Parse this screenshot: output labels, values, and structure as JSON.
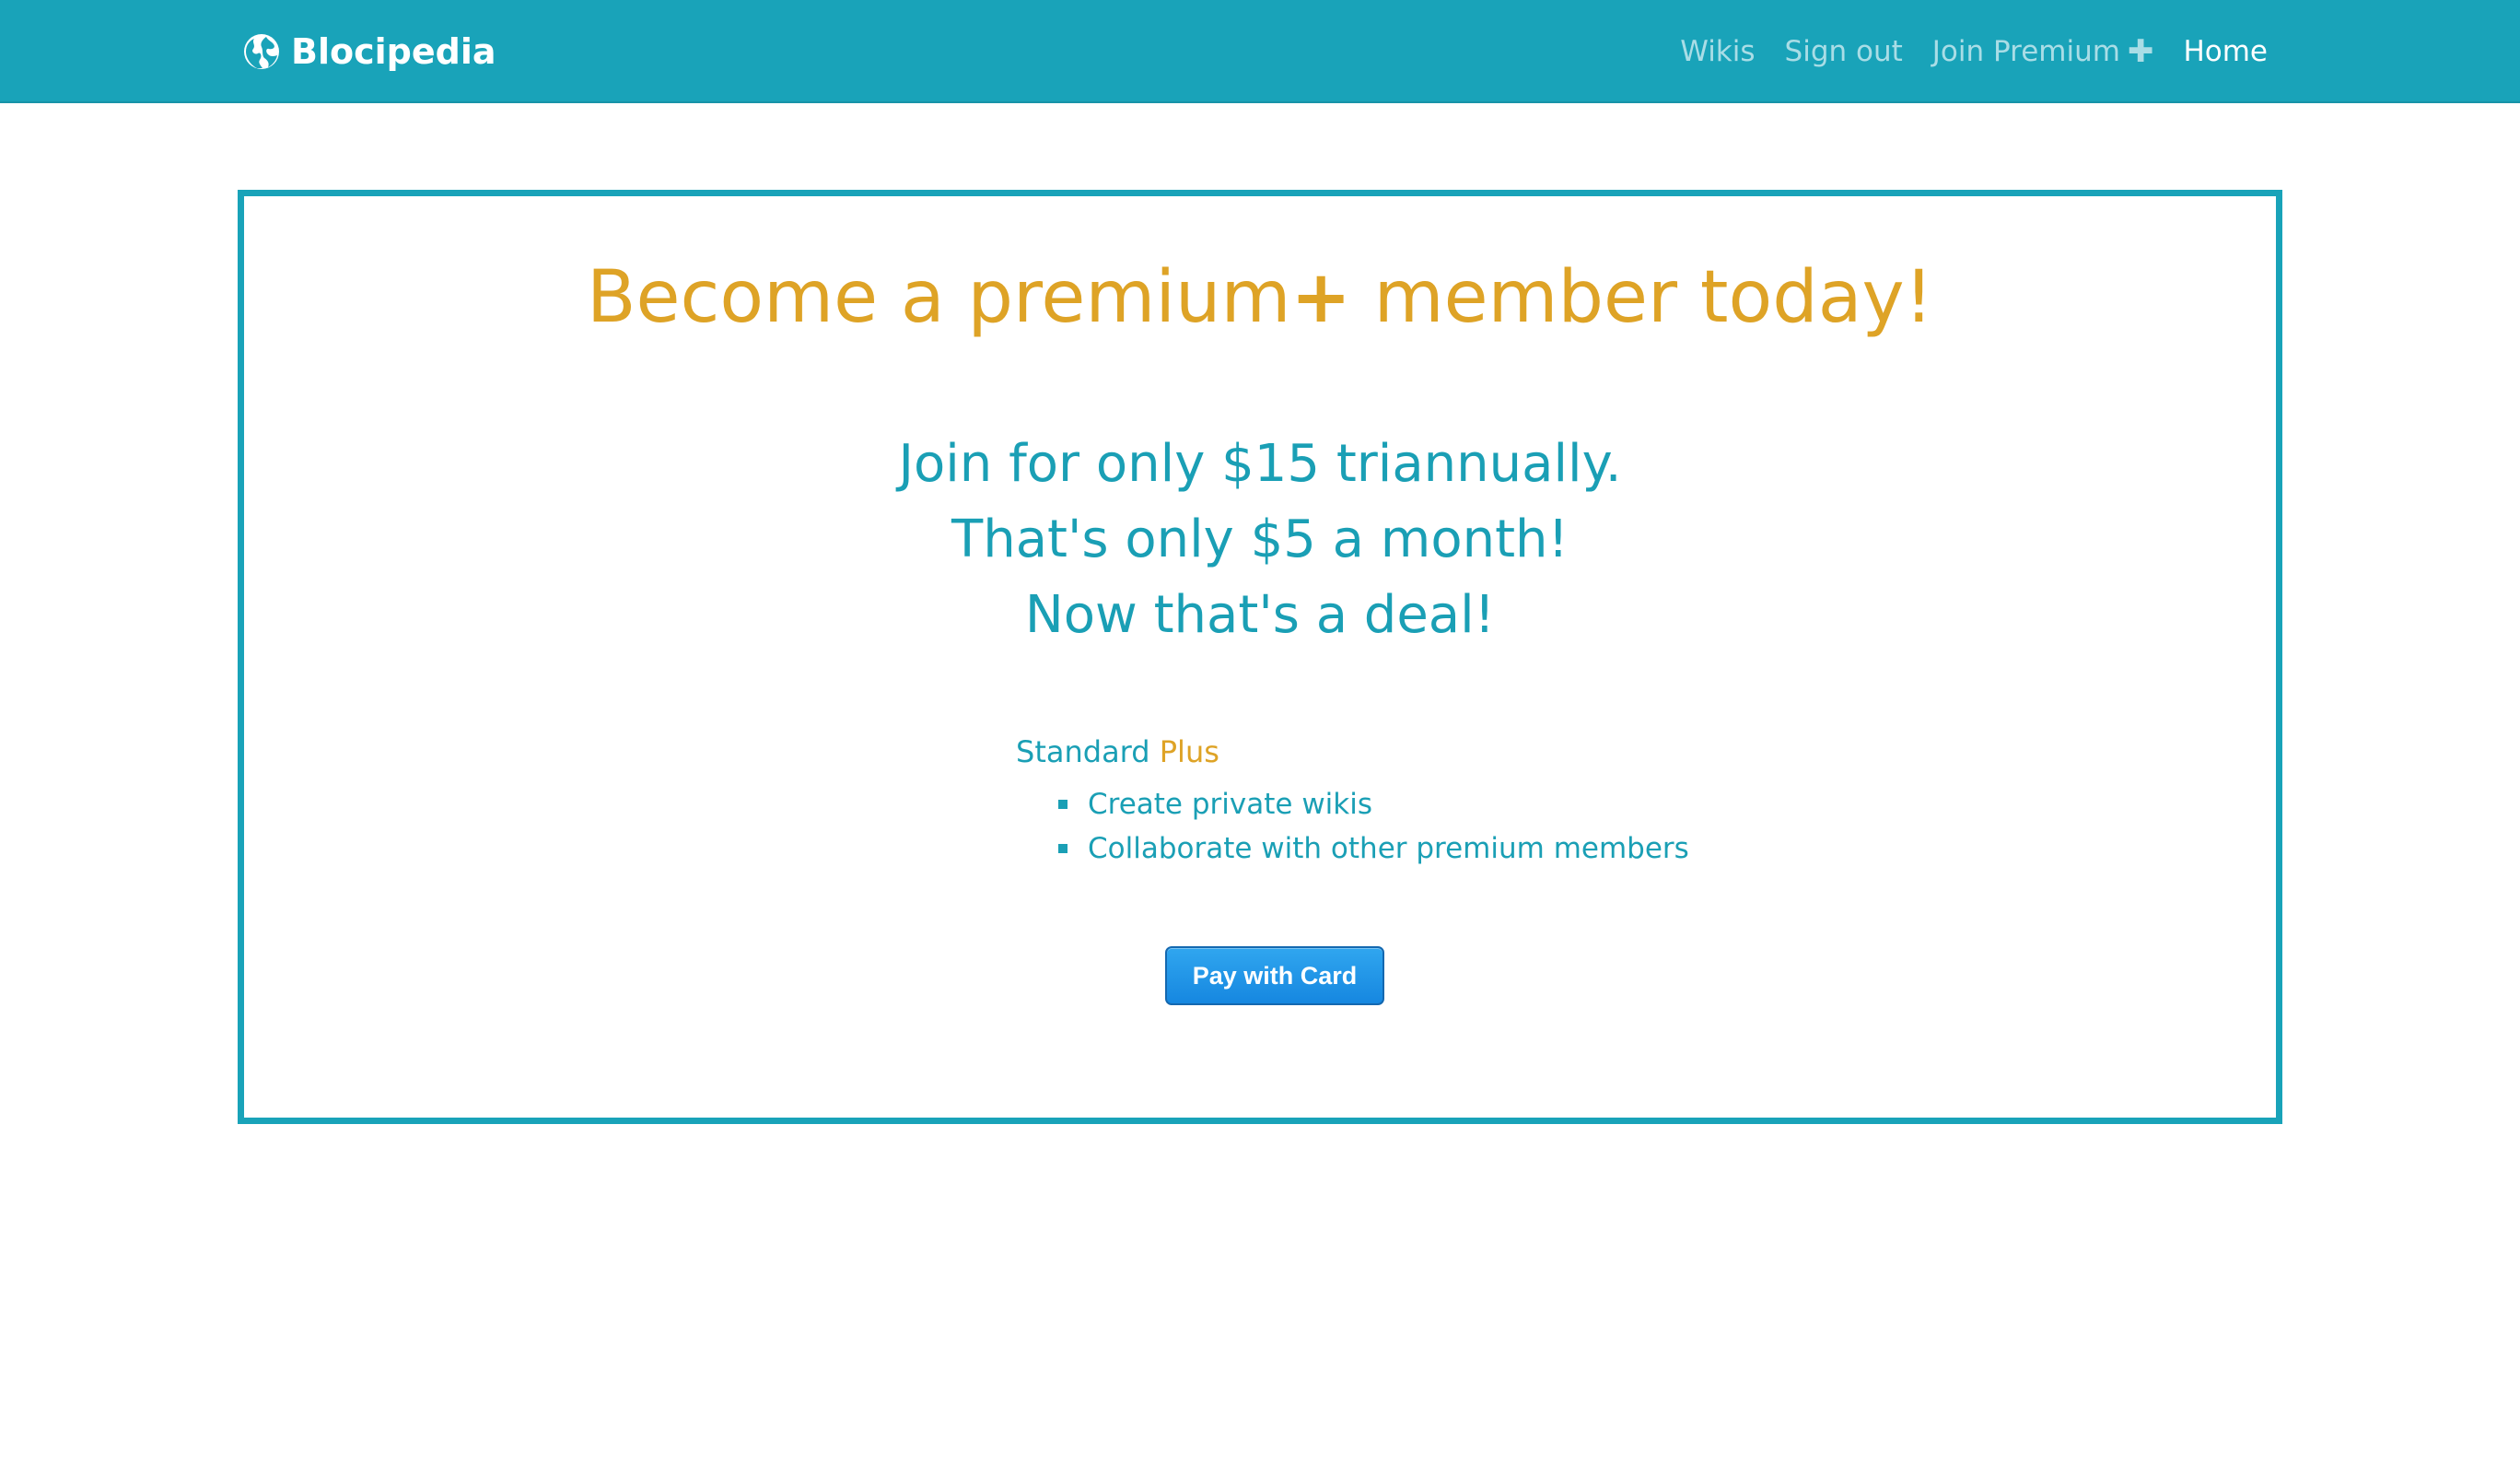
{
  "navbar": {
    "brand": "Blocipedia",
    "brand_icon": "globe-icon",
    "links": [
      {
        "label": "Wikis"
      },
      {
        "label": "Sign out"
      },
      {
        "label": "Join Premium",
        "icon": "plus-icon"
      },
      {
        "label": "Home",
        "active": true
      }
    ]
  },
  "main": {
    "headline_before": "Become a premium",
    "headline_plus": "+",
    "headline_after": " member today!",
    "pitch_lines": [
      "Join for only $15 triannually.",
      "That's only $5 a month!",
      "Now that's a deal!"
    ],
    "plan_name": "Standard",
    "plan_accent": "Plus",
    "features": [
      "Create private wikis",
      "Collaborate with other premium members"
    ],
    "pay_button_label": "Pay with Card"
  },
  "colors": {
    "nav_bg": "#19a3b9",
    "accent_gold": "#dea326",
    "text_teal": "#1a9fb5",
    "button_blue": "#1687e0"
  }
}
